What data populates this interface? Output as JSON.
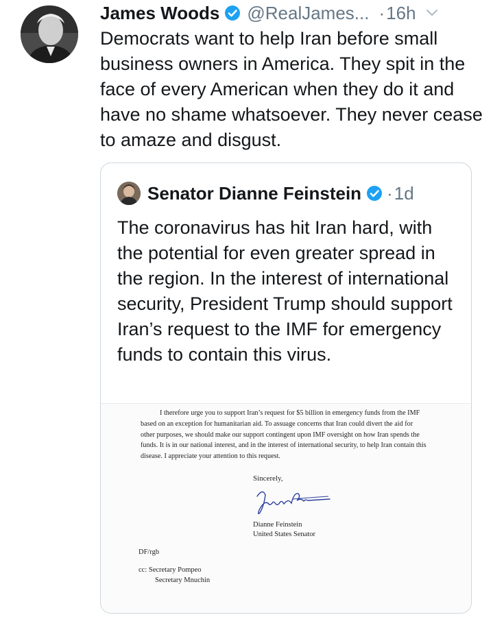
{
  "tweet": {
    "author_name": "James Woods",
    "handle": "@RealJames...",
    "separator": "·",
    "time": "16h",
    "text": "Democrats want to help Iran before small business owners in America. They spit in the face of every American when they do it and have no shame whatsoever. They never cease to amaze and disgust."
  },
  "quoted_tweet": {
    "author_name": "Senator Dianne Feinstein",
    "separator": "·",
    "time": "1d",
    "text": "The coronavirus has hit Iran hard, with the potential for even greater spread in the region. In the interest of international security, President Trump should support Iran’s request to the IMF for emergency funds to contain this virus."
  },
  "letter": {
    "body": "I therefore urge you to support Iran’s request for $5 billion in emergency funds from the IMF based on an exception for humanitarian aid. To assuage concerns that Iran could divert the aid for other purposes, we should make our support contingent upon IMF oversight on how Iran spends the funds. It is in our national interest, and in the interest of international security, to help Iran contain this disease. I appreciate your attention to this request.",
    "closing": "Sincerely,",
    "signature_text": "Dianne Feinstein",
    "signer_name": "Dianne Feinstein",
    "signer_title": "United States Senator",
    "initials": "DF/rgb",
    "cc_line1": "cc: Secretary Pompeo",
    "cc_line2": "Secretary Mnuchin"
  },
  "colors": {
    "text": "#14171a",
    "secondary": "#657786",
    "verified": "#1da1f2",
    "border": "#ccd6dd",
    "signature_ink": "#2b3f9e"
  },
  "icons": [
    "verified-badge-icon",
    "chevron-down-icon"
  ]
}
